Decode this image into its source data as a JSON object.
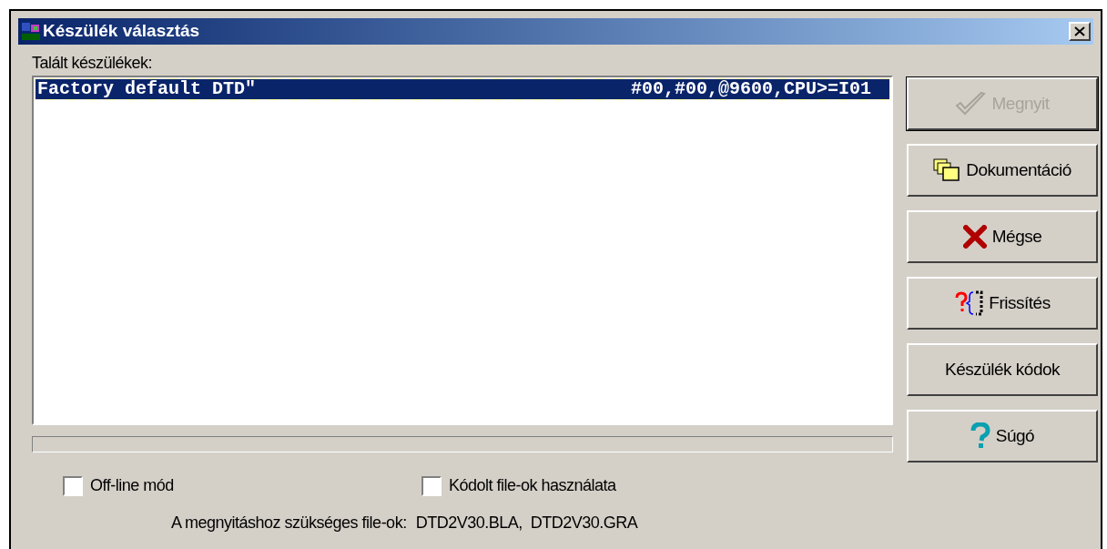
{
  "window": {
    "title": "Készülék választás"
  },
  "devices_label": "Talált készülékek:",
  "devices": [
    {
      "name": "Factory default DTD\"",
      "params": "#00,#00,@9600,CPU>=I01",
      "selected": true
    }
  ],
  "buttons": [
    {
      "label": "Megnyit",
      "kind": "check",
      "disabled": true
    },
    {
      "label": "Dokumentáció",
      "kind": "folders",
      "disabled": false
    },
    {
      "label": "Mégse",
      "kind": "cross",
      "disabled": false
    },
    {
      "label": "Frissítés",
      "kind": "refresh",
      "disabled": false
    },
    {
      "label": "Készülék kódok",
      "kind": "none",
      "disabled": false
    },
    {
      "label": "Súgó",
      "kind": "help",
      "disabled": false
    }
  ],
  "options": [
    {
      "label": "Off-line mód",
      "checked": false
    },
    {
      "label": "Kódolt file-ok használata",
      "checked": false
    }
  ],
  "required_files_label": "A megnyitáshoz szükséges file-ok:",
  "required_files": "DTD2V30.BLA,  DTD2V30.GRA"
}
